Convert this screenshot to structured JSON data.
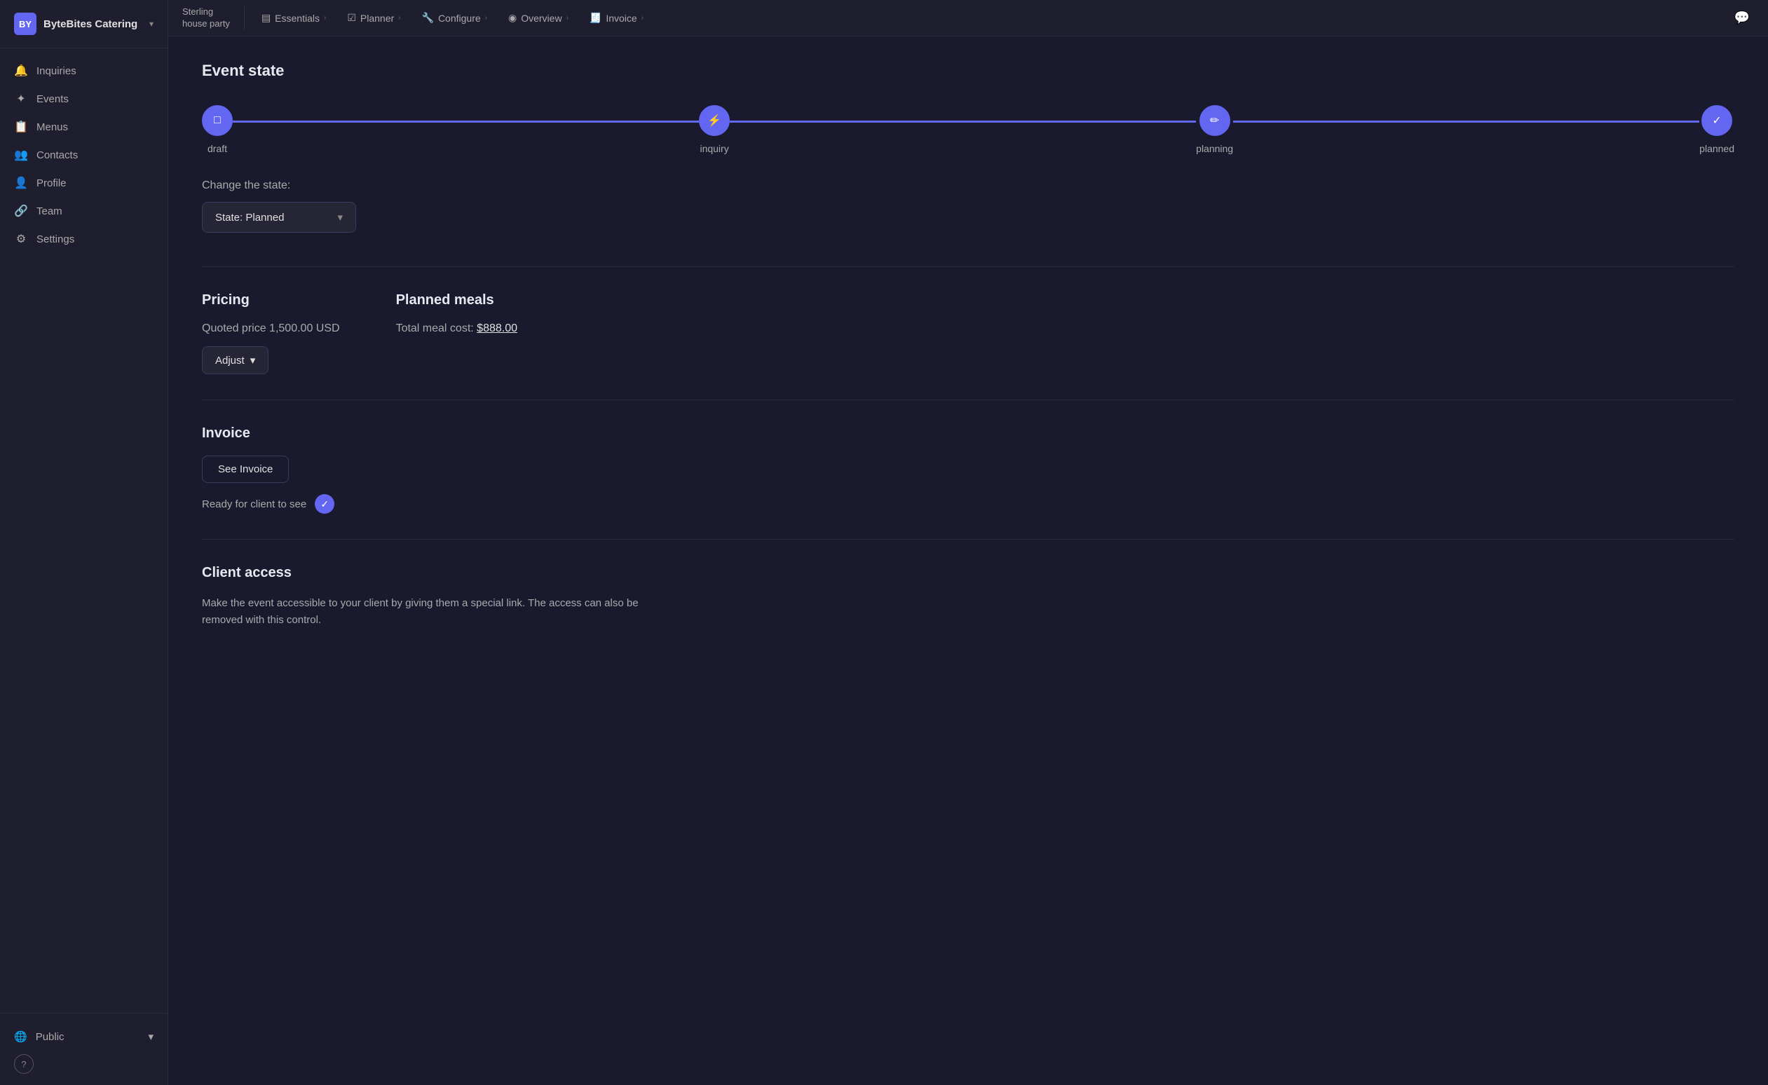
{
  "sidebar": {
    "logo": "BY",
    "company_name": "ByteBites Catering",
    "items": [
      {
        "id": "inquiries",
        "label": "Inquiries",
        "icon": "🔔"
      },
      {
        "id": "events",
        "label": "Events",
        "icon": "✦"
      },
      {
        "id": "menus",
        "label": "Menus",
        "icon": "📋"
      },
      {
        "id": "contacts",
        "label": "Contacts",
        "icon": "👥"
      },
      {
        "id": "profile",
        "label": "Profile",
        "icon": "👤"
      },
      {
        "id": "team",
        "label": "Team",
        "icon": "🔗"
      },
      {
        "id": "settings",
        "label": "Settings",
        "icon": "⚙"
      }
    ],
    "public_label": "Public",
    "help_label": "?"
  },
  "topbar": {
    "event_name_line1": "Sterling",
    "event_name_line2": "house party",
    "tabs": [
      {
        "id": "essentials",
        "label": "Essentials",
        "icon": "▤"
      },
      {
        "id": "planner",
        "label": "Planner",
        "icon": "☑"
      },
      {
        "id": "configure",
        "label": "Configure",
        "icon": "🔧"
      },
      {
        "id": "overview",
        "label": "Overview",
        "icon": "◉"
      },
      {
        "id": "invoice",
        "label": "Invoice",
        "icon": "🧾"
      }
    ]
  },
  "content": {
    "event_state": {
      "title": "Event state",
      "steps": [
        {
          "id": "draft",
          "label": "draft",
          "icon": "□"
        },
        {
          "id": "inquiry",
          "label": "inquiry",
          "icon": "⚡"
        },
        {
          "id": "planning",
          "label": "planning",
          "icon": "✏"
        },
        {
          "id": "planned",
          "label": "planned",
          "icon": "✓"
        }
      ],
      "change_state_label": "Change the state:",
      "state_dropdown_label": "State: Planned"
    },
    "pricing": {
      "title": "Pricing",
      "quoted_price_label": "Quoted price 1,500.00 USD",
      "adjust_label": "Adjust"
    },
    "planned_meals": {
      "title": "Planned meals",
      "total_meal_cost_label": "Total meal cost:",
      "total_meal_cost_value": "$888.00"
    },
    "invoice": {
      "title": "Invoice",
      "see_invoice_label": "See Invoice",
      "ready_label": "Ready for client to see"
    },
    "client_access": {
      "title": "Client access",
      "description": "Make the event accessible to your client by giving them a special link. The access can also be removed with this control."
    }
  }
}
